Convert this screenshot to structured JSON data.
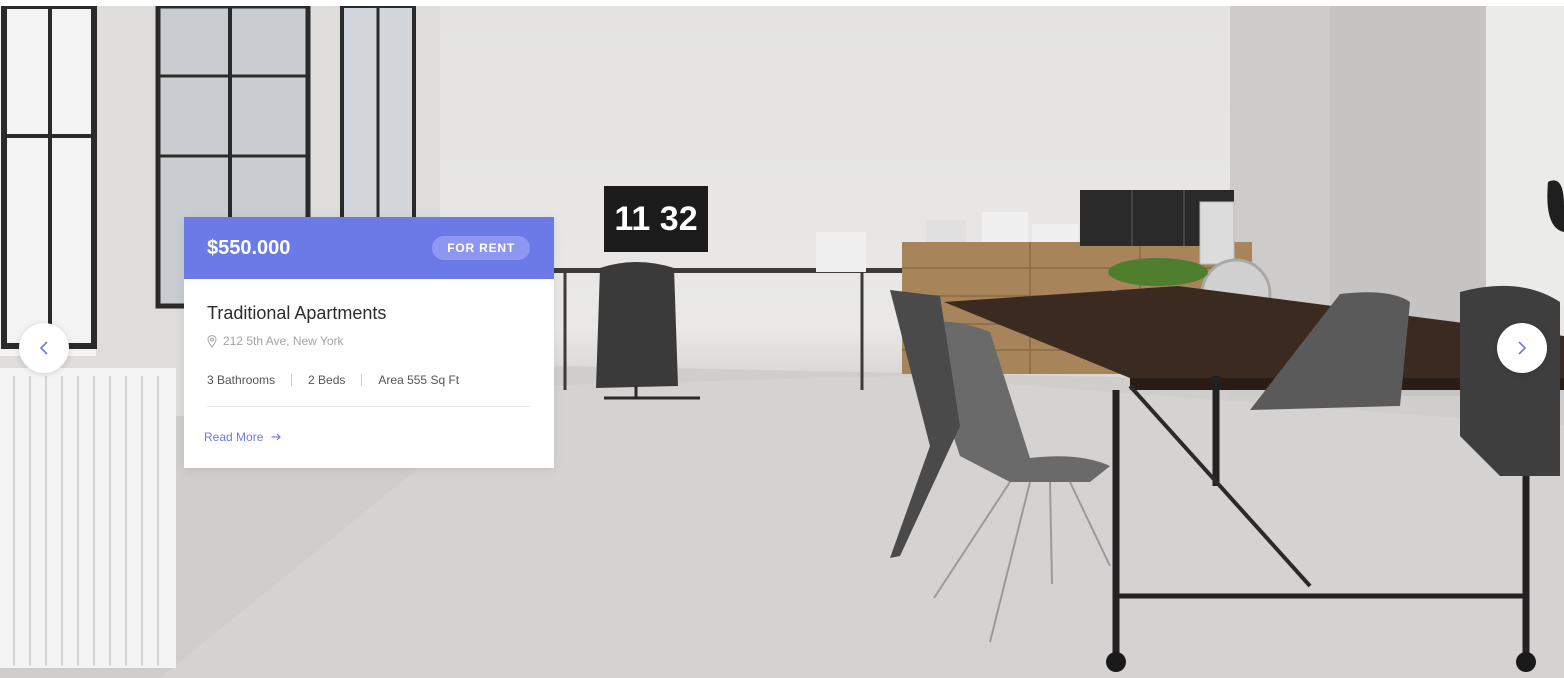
{
  "slider": {
    "prev_label": "Previous slide",
    "next_label": "Next slide"
  },
  "scene": {
    "clock_text": "11 32"
  },
  "property": {
    "price": "$550.000",
    "status": "FOR RENT",
    "title": "Traditional Apartments",
    "address": "212 5th Ave, New York",
    "features": [
      "3 Bathrooms",
      "2 Beds",
      "Area 555 Sq Ft"
    ],
    "read_more": "Read More"
  },
  "colors": {
    "accent": "#6c7ae8",
    "badge_bg": "#8d97f0"
  },
  "icons": {
    "location": "map-pin-icon",
    "read_more": "arrow-right-icon",
    "prev": "chevron-left-icon",
    "next": "chevron-right-icon"
  }
}
